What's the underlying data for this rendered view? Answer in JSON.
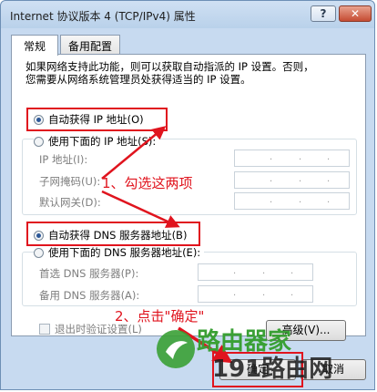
{
  "window": {
    "title": "Internet 协议版本 4 (TCP/IPv4) 属性"
  },
  "titlebar": {
    "help": "?",
    "close": "✕"
  },
  "tabs": [
    {
      "label": "常规"
    },
    {
      "label": "备用配置"
    }
  ],
  "intro": {
    "line1": "如果网络支持此功能，则可以获取自动指派的 IP 设置。否则，",
    "line2": "您需要从网络系统管理员处获得适当的 IP 设置。"
  },
  "ip": {
    "auto_label": "自动获得 IP 地址(O)",
    "manual_label": "使用下面的 IP 地址(S):",
    "fields": [
      {
        "label": "IP 地址(I):"
      },
      {
        "label": "子网掩码(U):"
      },
      {
        "label": "默认网关(D):"
      }
    ]
  },
  "dns": {
    "auto_label": "自动获得 DNS 服务器地址(B)",
    "manual_label": "使用下面的 DNS 服务器地址(E):",
    "fields": [
      {
        "label": "首选 DNS 服务器(P):"
      },
      {
        "label": "备用 DNS 服务器(A):"
      }
    ]
  },
  "validate": {
    "label": "退出时验证设置(L)"
  },
  "buttons": {
    "advanced": "高级(V)...",
    "ok": "确定",
    "cancel": "取消"
  },
  "annotations": {
    "step1": "1、勾选这两项",
    "step2": "2、点击\"确定\""
  },
  "watermark": {
    "line1": "路由器家",
    "line2": "191路由网"
  },
  "colors": {
    "annotation_red": "#e0141e",
    "watermark_green": "#3aa035"
  }
}
